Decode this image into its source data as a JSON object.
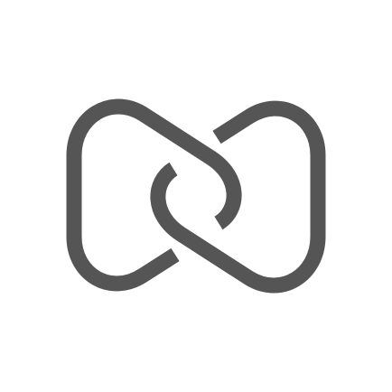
{
  "logo": {
    "icon": "interlocking-chain-links-icon",
    "background_color": "#ffffff",
    "stroke_color": "#555555"
  }
}
